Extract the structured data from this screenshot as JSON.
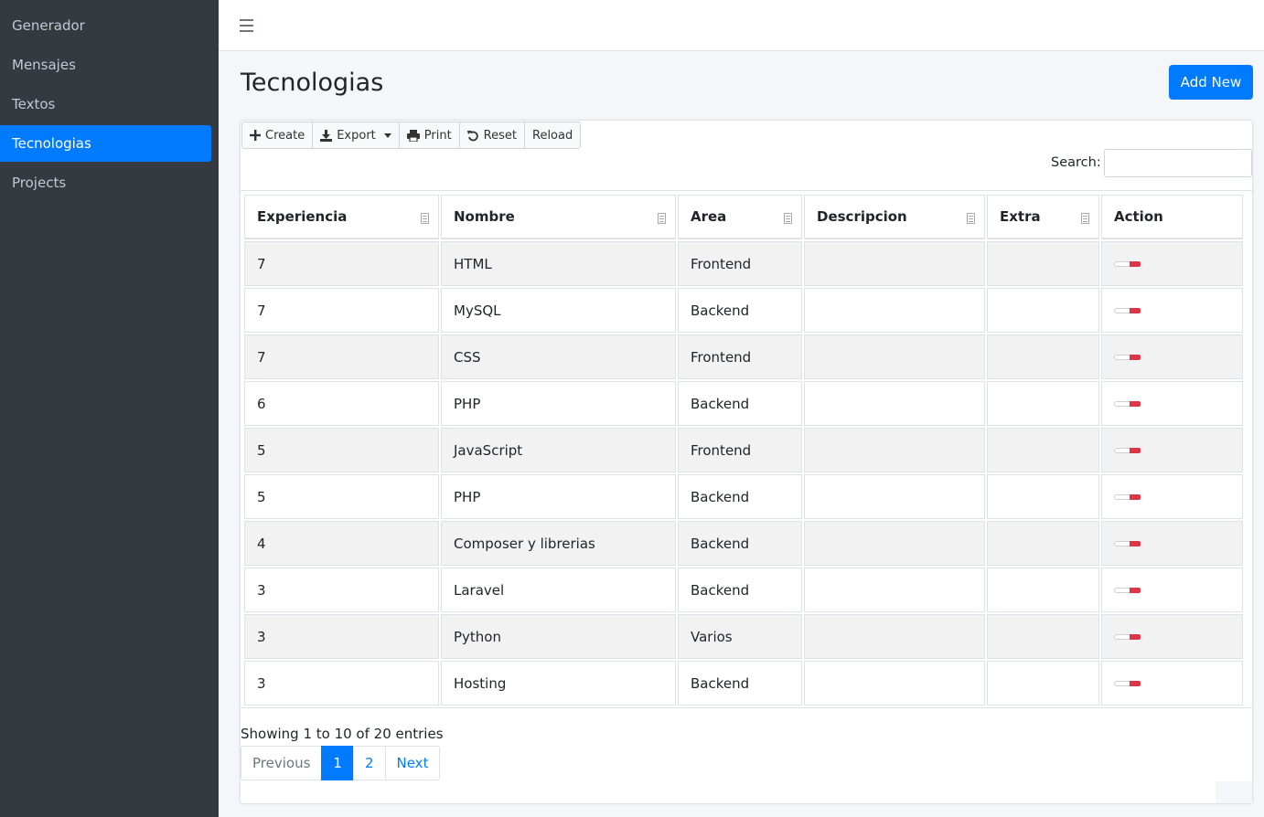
{
  "sidebar": {
    "items": [
      {
        "label": "Generador",
        "active": false
      },
      {
        "label": "Mensajes",
        "active": false
      },
      {
        "label": "Textos",
        "active": false
      },
      {
        "label": "Tecnologias",
        "active": true
      },
      {
        "label": "Projects",
        "active": false
      }
    ]
  },
  "header": {
    "menu_icon": "hamburger-icon"
  },
  "page": {
    "title": "Tecnologias",
    "add_new_label": "Add New"
  },
  "toolbar": {
    "buttons": [
      {
        "label": "Create",
        "icon": "plus-icon"
      },
      {
        "label": "Export",
        "icon": "download-icon"
      },
      {
        "label": "Print",
        "icon": "print-icon"
      },
      {
        "label": "Reset",
        "icon": "undo-icon"
      },
      {
        "label": "Reload",
        "icon": ""
      }
    ]
  },
  "search": {
    "label": "Search:",
    "value": ""
  },
  "table": {
    "columns": [
      "Experiencia",
      "Nombre",
      "Area",
      "Descripcion",
      "Extra",
      "Action"
    ],
    "rows": [
      {
        "experiencia": "7",
        "nombre": "HTML",
        "area": "Frontend",
        "descripcion": "",
        "extra": ""
      },
      {
        "experiencia": "7",
        "nombre": "MySQL",
        "area": "Backend",
        "descripcion": "",
        "extra": ""
      },
      {
        "experiencia": "7",
        "nombre": "CSS",
        "area": "Frontend",
        "descripcion": "",
        "extra": ""
      },
      {
        "experiencia": "6",
        "nombre": "PHP",
        "area": "Backend",
        "descripcion": "",
        "extra": ""
      },
      {
        "experiencia": "5",
        "nombre": "JavaScript",
        "area": "Frontend",
        "descripcion": "",
        "extra": ""
      },
      {
        "experiencia": "5",
        "nombre": "PHP",
        "area": "Backend",
        "descripcion": "",
        "extra": ""
      },
      {
        "experiencia": "4",
        "nombre": "Composer y librerias",
        "area": "Backend",
        "descripcion": "",
        "extra": ""
      },
      {
        "experiencia": "3",
        "nombre": "Laravel",
        "area": "Backend",
        "descripcion": "",
        "extra": ""
      },
      {
        "experiencia": "3",
        "nombre": "Python",
        "area": "Varios",
        "descripcion": "",
        "extra": ""
      },
      {
        "experiencia": "3",
        "nombre": "Hosting",
        "area": "Backend",
        "descripcion": "",
        "extra": ""
      }
    ]
  },
  "footer": {
    "info": "Showing 1 to 10 of 20 entries",
    "pagination": {
      "previous": "Previous",
      "pages": [
        "1",
        "2"
      ],
      "active_page": "1",
      "next": "Next"
    }
  },
  "colors": {
    "primary": "#007bff",
    "sidebar_bg": "#343a40",
    "toggle_on": "#dc3545"
  }
}
